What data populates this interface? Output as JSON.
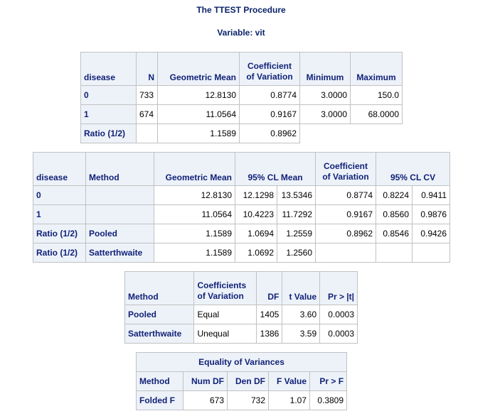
{
  "header": {
    "title": "The TTEST Procedure",
    "variable": "Variable: vit"
  },
  "stats_table": {
    "headers": [
      "disease",
      "N",
      "Geometric Mean",
      "Coefficient of Variation",
      "Minimum",
      "Maximum"
    ],
    "rows": [
      [
        "0",
        "733",
        "12.8130",
        "0.8774",
        "3.0000",
        "150.0"
      ],
      [
        "1",
        "674",
        "11.0564",
        "0.9167",
        "3.0000",
        "68.0000"
      ],
      [
        "Ratio (1/2)",
        "",
        "1.1589",
        "0.8962",
        "",
        ""
      ]
    ]
  },
  "ci_table": {
    "headers": [
      "disease",
      "Method",
      "Geometric Mean",
      "95% CL Mean",
      "Coefficient of Variation",
      "95% CL CV"
    ],
    "rows": [
      [
        "0",
        "",
        "12.8130",
        "12.1298",
        "13.5346",
        "0.8774",
        "0.8224",
        "0.9411"
      ],
      [
        "1",
        "",
        "11.0564",
        "10.4223",
        "11.7292",
        "0.9167",
        "0.8560",
        "0.9876"
      ],
      [
        "Ratio (1/2)",
        "Pooled",
        "1.1589",
        "1.0694",
        "1.2559",
        "0.8962",
        "0.8546",
        "0.9426"
      ],
      [
        "Ratio (1/2)",
        "Satterthwaite",
        "1.1589",
        "1.0692",
        "1.2560",
        "",
        "",
        ""
      ]
    ]
  },
  "ttest_table": {
    "headers": [
      "Method",
      "Coefficients of Variation",
      "DF",
      "t Value",
      "Pr > |t|"
    ],
    "rows": [
      [
        "Pooled",
        "Equal",
        "1405",
        "3.60",
        "0.0003"
      ],
      [
        "Satterthwaite",
        "Unequal",
        "1386",
        "3.59",
        "0.0003"
      ]
    ]
  },
  "variance_table": {
    "title": "Equality of Variances",
    "headers": [
      "Method",
      "Num DF",
      "Den DF",
      "F Value",
      "Pr > F"
    ],
    "rows": [
      [
        "Folded F",
        "673",
        "732",
        "1.07",
        "0.3809"
      ]
    ]
  }
}
